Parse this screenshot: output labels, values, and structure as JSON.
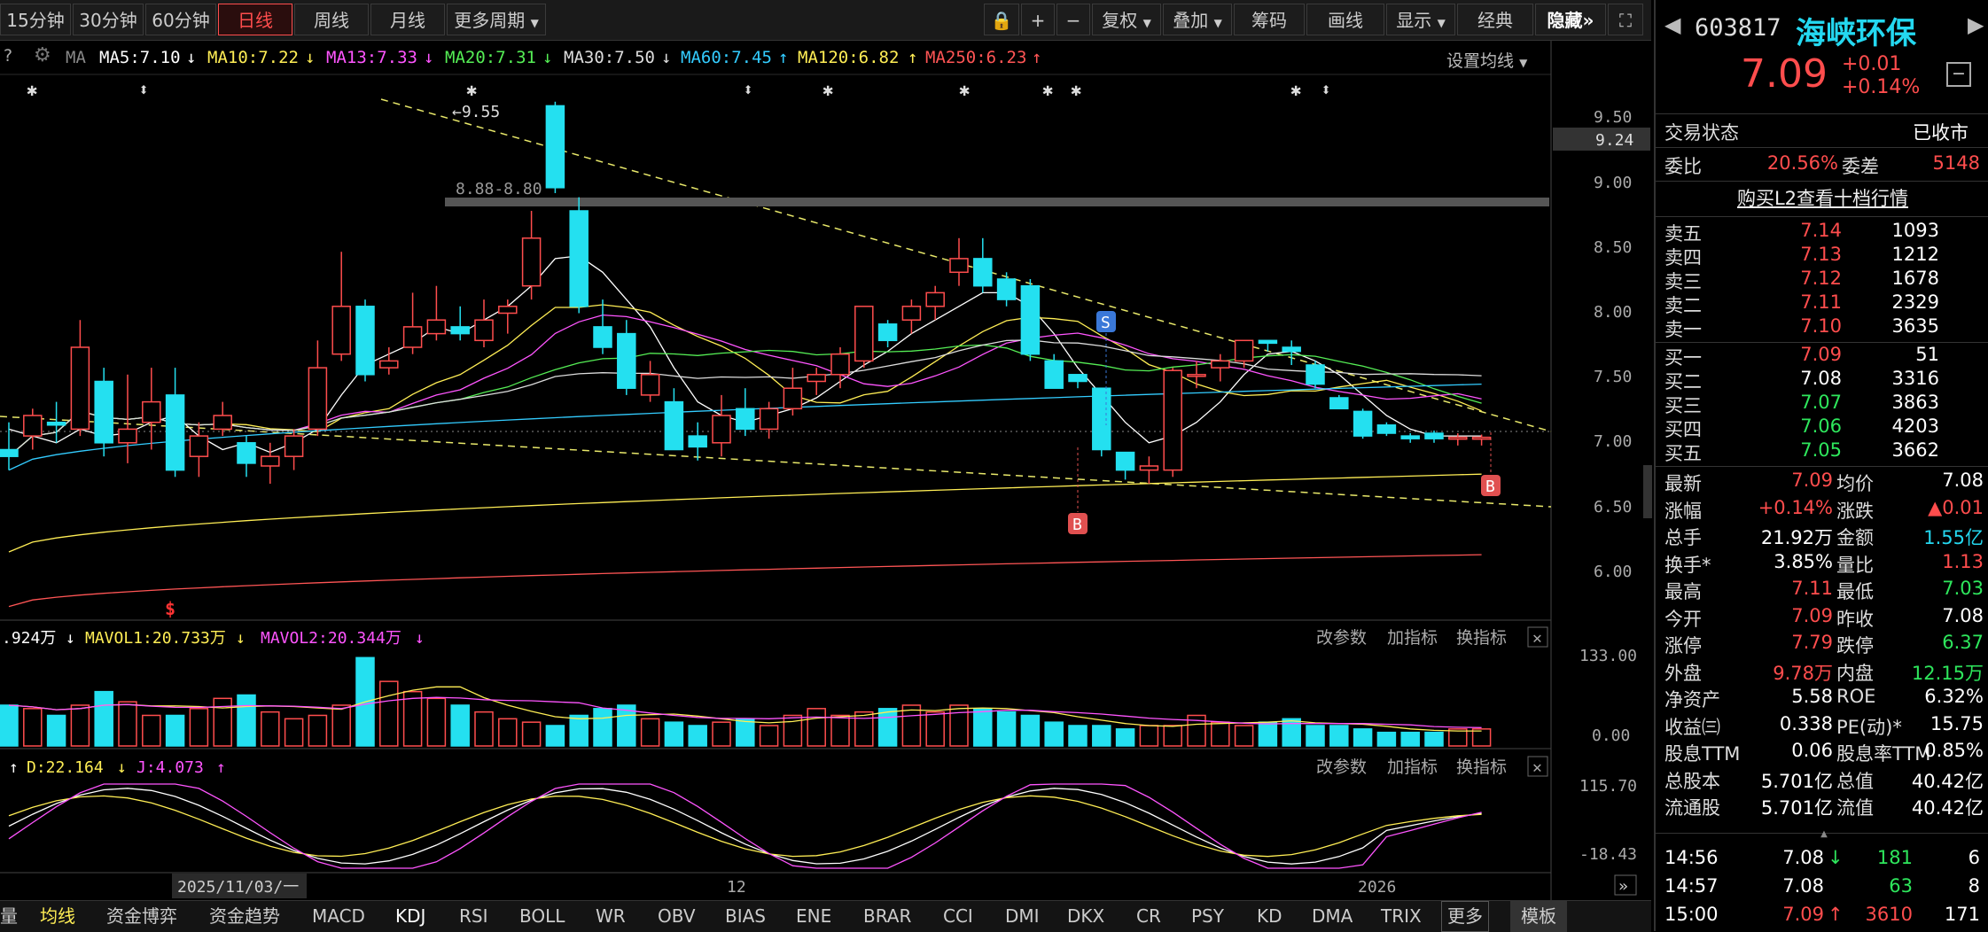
{
  "toolbar": {
    "periods": [
      "15分钟",
      "30分钟",
      "60分钟",
      "日线",
      "周线",
      "月线",
      "更多周期"
    ],
    "active_period": "日线",
    "tools": [
      "复权",
      "叠加",
      "筹码",
      "画线",
      "显示",
      "经典",
      "隐藏"
    ]
  },
  "ma_legend": {
    "prefix": "MA",
    "items": [
      {
        "label": "MA5:7.10",
        "arrow": "↓",
        "color": "#ffffff"
      },
      {
        "label": "MA10:7.22",
        "arrow": "↓",
        "color": "#ffee55"
      },
      {
        "label": "MA13:7.33",
        "arrow": "↓",
        "color": "#ff55ff"
      },
      {
        "label": "MA20:7.31",
        "arrow": "↓",
        "color": "#55ee55"
      },
      {
        "label": "MA30:7.50",
        "arrow": "↓",
        "color": "#dddddd"
      },
      {
        "label": "MA60:7.45",
        "arrow": "↑",
        "color": "#33ccff"
      },
      {
        "label": "MA120:6.82",
        "arrow": "↑",
        "color": "#ffee55"
      },
      {
        "label": "MA250:6.23",
        "arrow": "↑",
        "color": "#ff5555"
      }
    ],
    "settings_label": "设置均线"
  },
  "price_axis": {
    "ticks": [
      "9.50",
      "9.24",
      "9.00",
      "8.50",
      "8.00",
      "7.50",
      "7.00",
      "6.50",
      "6.00"
    ],
    "highlight": "9.24"
  },
  "annotations": {
    "high_label": "9.55",
    "range_label": "8.88-8.80",
    "sell_badge": "S",
    "buy_badge": "B",
    "dollar_marker": "$"
  },
  "volume_panel": {
    "legend": [
      {
        "label": ".924万",
        "arrow": "↓",
        "color": "#ffffff"
      },
      {
        "label": "MAVOL1:20.733万",
        "arrow": "↓",
        "color": "#ffee55"
      },
      {
        "label": "MAVOL2:20.344万",
        "arrow": "↓",
        "color": "#ff55ff"
      }
    ],
    "buttons": [
      "改参数",
      "加指标",
      "换指标"
    ],
    "axis": [
      "133.00",
      "0.00"
    ]
  },
  "kdj_panel": {
    "legend": [
      {
        "label": "D:22.164",
        "arrow": "↓",
        "color": "#ffee55"
      },
      {
        "label": "J:4.073",
        "arrow": "↑",
        "color": "#ff55ff"
      }
    ],
    "buttons": [
      "改参数",
      "加指标",
      "换指标"
    ],
    "axis": [
      "115.70",
      "-18.43"
    ]
  },
  "date_axis": {
    "cursor_date": "2025/11/03/一",
    "labels": [
      "12",
      "2026"
    ]
  },
  "bottom_tabs": [
    "量",
    "均线",
    "资金博弈",
    "资金趋势",
    "MACD",
    "KDJ",
    "RSI",
    "BOLL",
    "WR",
    "OBV",
    "BIAS",
    "ENE",
    "BRAR",
    "CCI",
    "DMI",
    "DKX",
    "CR",
    "PSY",
    "KD",
    "DMA",
    "TRIX",
    "更多",
    "模板"
  ],
  "active_tab": "KDJ",
  "stock": {
    "code": "603817",
    "name": "海峡环保",
    "price": "7.09",
    "change": "+0.01",
    "change_pct": "+0.14%",
    "status_label": "交易状态",
    "status": "已收市",
    "webi_label": "委比",
    "webi": "20.56%",
    "weicha_label": "委差",
    "weicha": "5148",
    "l2_link": "购买L2查看十档行情"
  },
  "order_book": {
    "asks": [
      {
        "label": "卖五",
        "price": "7.14",
        "vol": "1093"
      },
      {
        "label": "卖四",
        "price": "7.13",
        "vol": "1212"
      },
      {
        "label": "卖三",
        "price": "7.12",
        "vol": "1678"
      },
      {
        "label": "卖二",
        "price": "7.11",
        "vol": "2329"
      },
      {
        "label": "卖一",
        "price": "7.10",
        "vol": "3635"
      }
    ],
    "bids": [
      {
        "label": "买一",
        "price": "7.09",
        "vol": "51",
        "color": "up"
      },
      {
        "label": "买二",
        "price": "7.08",
        "vol": "3316",
        "color": "wh"
      },
      {
        "label": "买三",
        "price": "7.07",
        "vol": "3863",
        "color": "dn"
      },
      {
        "label": "买四",
        "price": "7.06",
        "vol": "4203",
        "color": "dn"
      },
      {
        "label": "买五",
        "price": "7.05",
        "vol": "3662",
        "color": "dn"
      }
    ]
  },
  "stats": [
    {
      "l1": "最新",
      "v1": "7.09",
      "c1": "up",
      "l2": "均价",
      "v2": "7.08",
      "c2": "wh"
    },
    {
      "l1": "涨幅",
      "v1": "+0.14%",
      "c1": "up",
      "l2": "涨跌",
      "v2": "▲0.01",
      "c2": "up"
    },
    {
      "l1": "总手",
      "v1": "21.92万",
      "c1": "wh",
      "l2": "金额",
      "v2": "1.55亿",
      "c2": "cy"
    },
    {
      "l1": "换手*",
      "v1": "3.85%",
      "c1": "wh",
      "l2": "量比",
      "v2": "1.13",
      "c2": "up"
    },
    {
      "l1": "最高",
      "v1": "7.11",
      "c1": "up",
      "l2": "最低",
      "v2": "7.03",
      "c2": "dn"
    },
    {
      "l1": "今开",
      "v1": "7.09",
      "c1": "up",
      "l2": "昨收",
      "v2": "7.08",
      "c2": "wh"
    },
    {
      "l1": "涨停",
      "v1": "7.79",
      "c1": "up",
      "l2": "跌停",
      "v2": "6.37",
      "c2": "dn"
    },
    {
      "l1": "外盘",
      "v1": "9.78万",
      "c1": "up",
      "l2": "内盘",
      "v2": "12.15万",
      "c2": "dn"
    },
    {
      "l1": "净资产",
      "v1": "5.58",
      "c1": "wh",
      "l2": "ROE",
      "v2": "6.32%",
      "c2": "wh"
    },
    {
      "l1": "收益㈢",
      "v1": "0.338",
      "c1": "wh",
      "l2": "PE(动)*",
      "v2": "15.75",
      "c2": "wh"
    },
    {
      "l1": "股息TTM",
      "v1": "0.06",
      "c1": "wh",
      "l2": "股息率TTM",
      "v2": "0.85%",
      "c2": "wh"
    },
    {
      "l1": "总股本",
      "v1": "5.701亿",
      "c1": "wh",
      "l2": "总值",
      "v2": "40.42亿",
      "c2": "wh"
    },
    {
      "l1": "流通股",
      "v1": "5.701亿",
      "c1": "wh",
      "l2": "流值",
      "v2": "40.42亿",
      "c2": "wh"
    }
  ],
  "ticks": [
    {
      "time": "14:56",
      "price": "7.08",
      "arrow": "↓",
      "vol": "181",
      "n": "6",
      "vcolor": "dn"
    },
    {
      "time": "14:57",
      "price": "7.08",
      "arrow": "",
      "vol": "63",
      "n": "8",
      "vcolor": "dn"
    },
    {
      "time": "15:00",
      "price": "7.09",
      "arrow": "↑",
      "vol": "3610",
      "n": "171",
      "vcolor": "up"
    }
  ],
  "chart_data": {
    "type": "candlestick",
    "price_range": [
      5.75,
      9.75
    ],
    "candles": [
      [
        7.0,
        7.2,
        6.85,
        6.95
      ],
      [
        7.1,
        7.3,
        7.0,
        7.25
      ],
      [
        7.2,
        7.35,
        7.05,
        7.18
      ],
      [
        7.15,
        7.95,
        7.1,
        7.75
      ],
      [
        7.5,
        7.6,
        6.95,
        7.05
      ],
      [
        7.05,
        7.55,
        6.9,
        7.15
      ],
      [
        7.2,
        7.6,
        7.0,
        7.35
      ],
      [
        7.4,
        7.6,
        6.8,
        6.85
      ],
      [
        6.95,
        7.2,
        6.8,
        7.1
      ],
      [
        7.15,
        7.35,
        7.1,
        7.25
      ],
      [
        7.05,
        7.1,
        6.8,
        6.9
      ],
      [
        6.88,
        7.05,
        6.75,
        6.95
      ],
      [
        6.95,
        7.15,
        6.85,
        7.1
      ],
      [
        7.15,
        7.8,
        7.1,
        7.6
      ],
      [
        7.7,
        8.45,
        7.65,
        8.05
      ],
      [
        8.05,
        8.1,
        7.5,
        7.55
      ],
      [
        7.6,
        7.75,
        7.55,
        7.65
      ],
      [
        7.75,
        8.15,
        7.7,
        7.9
      ],
      [
        7.85,
        8.2,
        7.8,
        7.95
      ],
      [
        7.9,
        8.05,
        7.8,
        7.85
      ],
      [
        7.8,
        8.1,
        7.75,
        7.95
      ],
      [
        8.0,
        8.1,
        7.85,
        8.05
      ],
      [
        8.2,
        8.75,
        8.1,
        8.55
      ],
      [
        9.52,
        9.55,
        8.88,
        8.92
      ],
      [
        8.75,
        8.85,
        8.0,
        8.05
      ],
      [
        7.9,
        8.1,
        7.7,
        7.75
      ],
      [
        7.85,
        7.95,
        7.4,
        7.45
      ],
      [
        7.4,
        7.65,
        7.35,
        7.55
      ],
      [
        7.35,
        7.45,
        7.0,
        7.0
      ],
      [
        7.1,
        7.2,
        6.92,
        7.02
      ],
      [
        7.05,
        7.4,
        6.95,
        7.25
      ],
      [
        7.3,
        7.45,
        7.1,
        7.15
      ],
      [
        7.15,
        7.35,
        7.08,
        7.3
      ],
      [
        7.3,
        7.6,
        7.25,
        7.45
      ],
      [
        7.5,
        7.6,
        7.4,
        7.55
      ],
      [
        7.55,
        7.75,
        7.45,
        7.7
      ],
      [
        7.65,
        8.05,
        7.6,
        8.05
      ],
      [
        7.92,
        7.95,
        7.75,
        7.8
      ],
      [
        7.95,
        8.1,
        7.85,
        8.05
      ],
      [
        8.05,
        8.2,
        7.95,
        8.15
      ],
      [
        8.3,
        8.55,
        8.2,
        8.4
      ],
      [
        8.4,
        8.55,
        8.15,
        8.2
      ],
      [
        8.25,
        8.3,
        8.05,
        8.1
      ],
      [
        8.2,
        8.25,
        7.65,
        7.7
      ],
      [
        7.65,
        7.7,
        7.45,
        7.45
      ],
      [
        7.55,
        7.55,
        7.45,
        7.5
      ],
      [
        7.45,
        7.45,
        6.95,
        7.0
      ],
      [
        6.98,
        6.98,
        6.78,
        6.85
      ],
      [
        6.85,
        6.95,
        6.75,
        6.88
      ],
      [
        6.85,
        7.6,
        6.8,
        7.58
      ],
      [
        7.55,
        7.65,
        7.45,
        7.55
      ],
      [
        7.6,
        7.7,
        7.5,
        7.65
      ],
      [
        7.65,
        7.8,
        7.6,
        7.8
      ],
      [
        7.8,
        7.8,
        7.72,
        7.78
      ],
      [
        7.75,
        7.8,
        7.62,
        7.72
      ],
      [
        7.62,
        7.65,
        7.45,
        7.48
      ],
      [
        7.38,
        7.4,
        7.3,
        7.3
      ],
      [
        7.28,
        7.3,
        7.08,
        7.1
      ],
      [
        7.18,
        7.2,
        7.1,
        7.12
      ],
      [
        7.1,
        7.12,
        7.05,
        7.08
      ],
      [
        7.12,
        7.14,
        7.05,
        7.08
      ],
      [
        7.08,
        7.12,
        7.03,
        7.09
      ],
      [
        7.09,
        7.11,
        7.03,
        7.09
      ]
    ],
    "volumes": [
      60,
      55,
      45,
      60,
      80,
      65,
      45,
      45,
      55,
      70,
      75,
      50,
      40,
      45,
      60,
      130,
      95,
      80,
      70,
      60,
      50,
      40,
      35,
      30,
      45,
      55,
      60,
      40,
      35,
      30,
      35,
      40,
      30,
      45,
      55,
      45,
      50,
      55,
      60,
      50,
      60,
      55,
      50,
      45,
      35,
      30,
      30,
      25,
      30,
      30,
      45,
      35,
      30,
      35,
      40,
      30,
      30,
      25,
      20,
      20,
      20,
      25,
      25
    ],
    "ma5": [
      7.15,
      7.1,
      7.05,
      7.15,
      7.1,
      7.12,
      7.2,
      7.25,
      7.1,
      7.0,
      7.05,
      6.98,
      7.05,
      7.15,
      7.4,
      7.62,
      7.7,
      7.78,
      7.9,
      7.85,
      7.95,
      8.05,
      8.2,
      8.4,
      8.42,
      8.3,
      8.1,
      7.9,
      7.6,
      7.35,
      7.25,
      7.2,
      7.25,
      7.3,
      7.38,
      7.5,
      7.62,
      7.72,
      7.85,
      7.95,
      8.05,
      8.15,
      8.15,
      8.05,
      7.85,
      7.6,
      7.4,
      7.2,
      7.05,
      7.1,
      7.2,
      7.35,
      7.55,
      7.7,
      7.72,
      7.65,
      7.55,
      7.4,
      7.25,
      7.15,
      7.1,
      7.1,
      7.1
    ]
  }
}
